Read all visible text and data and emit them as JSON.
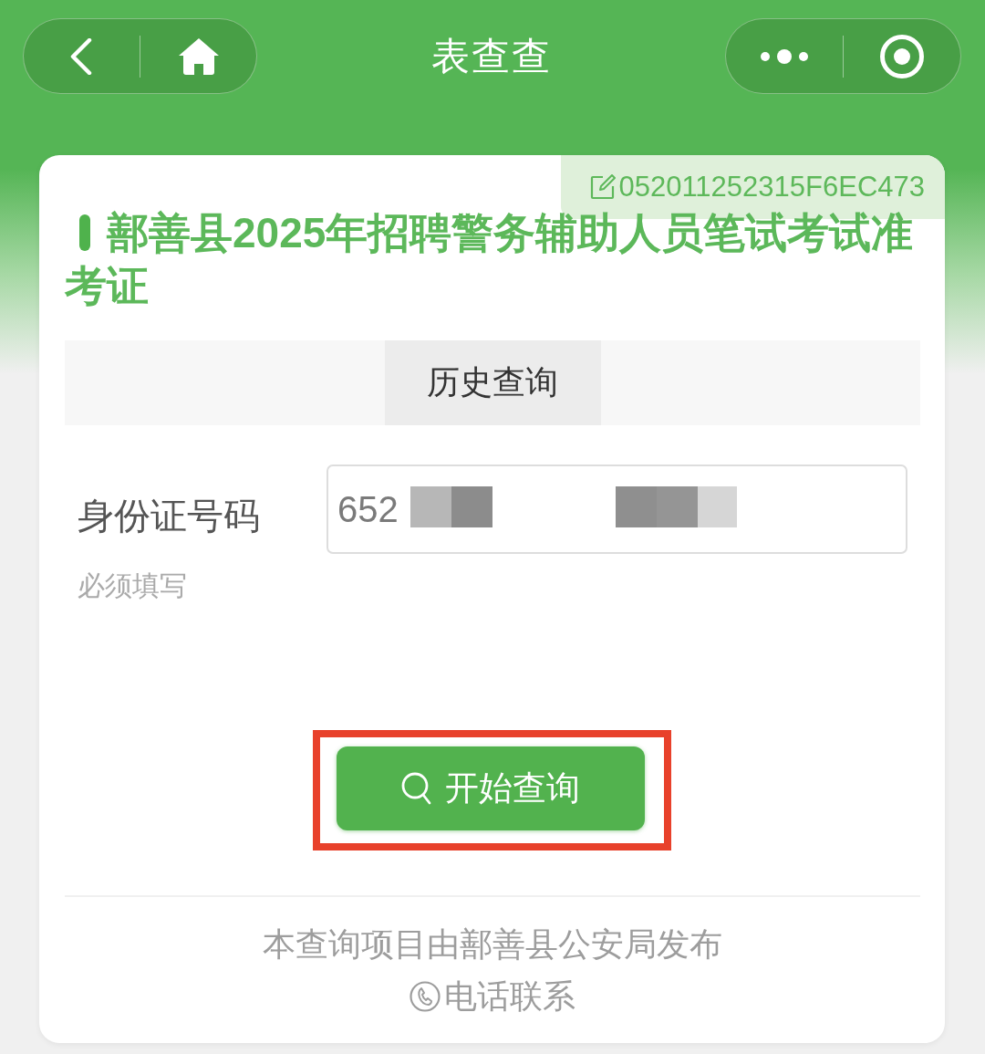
{
  "nav_bar": {
    "title": "表查查"
  },
  "access_code": "052011252315F6EC473",
  "form_title": "鄯善县2025年招聘警务辅助人员笔试考试准考证",
  "tabs": [
    {
      "label": "历史查询",
      "selected": true
    }
  ],
  "fields": [
    {
      "label": "身份证号码",
      "value": "652",
      "redacted": true,
      "hint": "必须填写"
    }
  ],
  "submit_button": {
    "label": "开始查询",
    "highlighted": true
  },
  "footer": {
    "publisher_note": "本查询项目由鄯善县公安局发布",
    "contact_link": "电话联系"
  }
}
